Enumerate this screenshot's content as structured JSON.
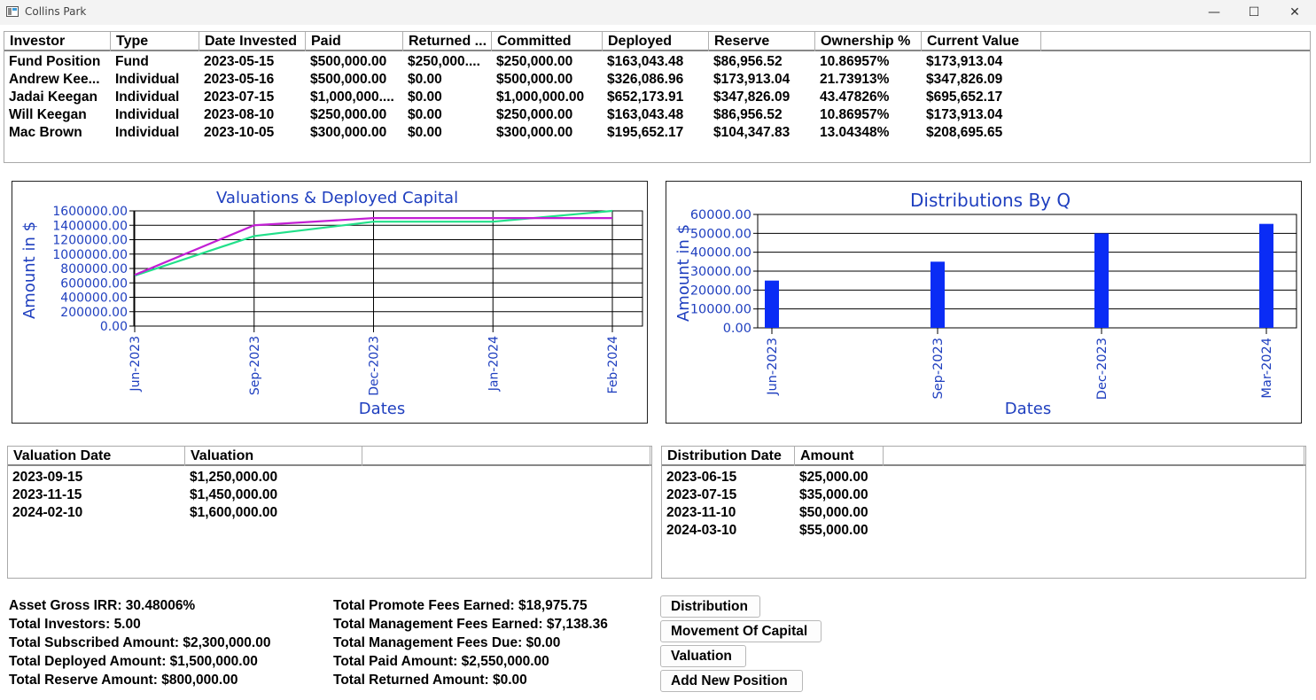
{
  "window": {
    "title": "Collins Park",
    "minimize": "—",
    "maximize": "☐",
    "close": "✕"
  },
  "investors_table": {
    "headers": [
      "Investor",
      "Type",
      "Date Invested",
      "Paid",
      "Returned ...",
      "Committed",
      "Deployed",
      "Reserve",
      "Ownership %",
      "Current Value"
    ],
    "rows": [
      [
        "Fund Position",
        "Fund",
        "2023-05-15",
        "$500,000.00",
        "$250,000....",
        "$250,000.00",
        "$163,043.48",
        "$86,956.52",
        "10.86957%",
        "$173,913.04"
      ],
      [
        "Andrew Kee...",
        "Individual",
        "2023-05-16",
        "$500,000.00",
        "$0.00",
        "$500,000.00",
        "$326,086.96",
        "$173,913.04",
        "21.73913%",
        "$347,826.09"
      ],
      [
        "Jadai Keegan",
        "Individual",
        "2023-07-15",
        "$1,000,000....",
        "$0.00",
        "$1,000,000.00",
        "$652,173.91",
        "$347,826.09",
        "43.47826%",
        "$695,652.17"
      ],
      [
        "Will Keegan",
        "Individual",
        "2023-08-10",
        "$250,000.00",
        "$0.00",
        "$250,000.00",
        "$163,043.48",
        "$86,956.52",
        "10.86957%",
        "$173,913.04"
      ],
      [
        "Mac Brown",
        "Individual",
        "2023-10-05",
        "$300,000.00",
        "$0.00",
        "$300,000.00",
        "$195,652.17",
        "$104,347.83",
        "13.04348%",
        "$208,695.65"
      ]
    ]
  },
  "chart_data": [
    {
      "type": "line",
      "title": "Valuations & Deployed Capital",
      "xlabel": "Dates",
      "ylabel": "Amount in $",
      "x": [
        "Jun-2023",
        "Sep-2023",
        "Dec-2023",
        "Jan-2024",
        "Feb-2024"
      ],
      "yticks": [
        "0.00",
        "200000.00",
        "400000.00",
        "600000.00",
        "800000.00",
        "1000000.00",
        "1200000.00",
        "1400000.00",
        "1600000.00"
      ],
      "ylim": [
        0,
        1600000
      ],
      "grid": true,
      "series": [
        {
          "color": "#22e08a",
          "values": [
            700000,
            1250000,
            1450000,
            1450000,
            1600000
          ]
        },
        {
          "color": "#c21fd4",
          "values": [
            710000,
            1400000,
            1500000,
            1500000,
            1500000
          ]
        }
      ]
    },
    {
      "type": "bar",
      "title": "Distributions By Q",
      "xlabel": "Dates",
      "ylabel": "Amount in $",
      "categories": [
        "Jun-2023",
        "Sep-2023",
        "Dec-2023",
        "Mar-2024"
      ],
      "values": [
        25000,
        35000,
        50000,
        55000
      ],
      "yticks": [
        "0.00",
        "10000.00",
        "20000.00",
        "30000.00",
        "40000.00",
        "50000.00",
        "60000.00"
      ],
      "ylim": [
        0,
        60000
      ],
      "grid": true,
      "color": "#0a2cf5"
    }
  ],
  "valuations_table": {
    "headers": [
      "Valuation Date",
      "Valuation"
    ],
    "rows": [
      [
        "2023-09-15",
        "$1,250,000.00"
      ],
      [
        "2023-11-15",
        "$1,450,000.00"
      ],
      [
        "2024-02-10",
        "$1,600,000.00"
      ]
    ]
  },
  "distributions_table": {
    "headers": [
      "Distribution Date",
      "Amount"
    ],
    "rows": [
      [
        "2023-06-15",
        "$25,000.00"
      ],
      [
        "2023-07-15",
        "$35,000.00"
      ],
      [
        "2023-11-10",
        "$50,000.00"
      ],
      [
        "2024-03-10",
        "$55,000.00"
      ]
    ]
  },
  "stats_left": [
    "Asset Gross IRR: 30.48006%",
    "Total Investors: 5.00",
    "Total Subscribed Amount: $2,300,000.00",
    "Total Deployed Amount: $1,500,000.00",
    "Total Reserve Amount: $800,000.00"
  ],
  "stats_right": [
    "Total Promote Fees Earned: $18,975.75",
    "Total Management Fees Earned: $7,138.36",
    "Total Management Fees Due: $0.00",
    "Total Paid Amount: $2,550,000.00",
    "Total Returned Amount: $0.00"
  ],
  "buttons": {
    "distribution": "Distribution",
    "movement_of_capital": "Movement Of Capital",
    "valuation": "Valuation",
    "add_new_position": "Add New Position"
  }
}
